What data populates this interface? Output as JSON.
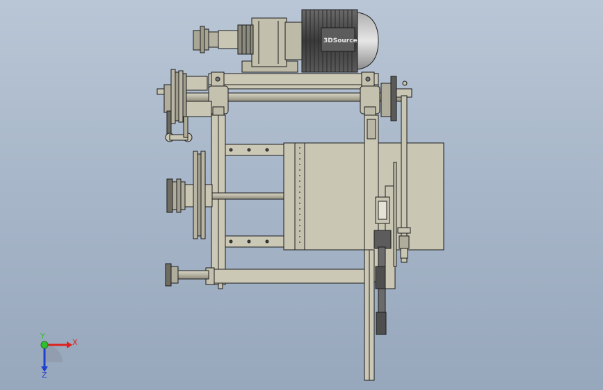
{
  "viewport": {
    "background_top": "#b9c6d6",
    "background_bottom": "#97a7bc"
  },
  "model": {
    "motor_label": "3DSource",
    "part_fill": "#c9c6b4",
    "dark_fill": "#4e4e4e",
    "edge_color": "#1c1c1c"
  },
  "triad": {
    "x_label": "X",
    "y_label": "Y",
    "z_label": "Z",
    "x_color": "#e02020",
    "y_color": "#2fbf2f",
    "z_color": "#2040d0"
  }
}
